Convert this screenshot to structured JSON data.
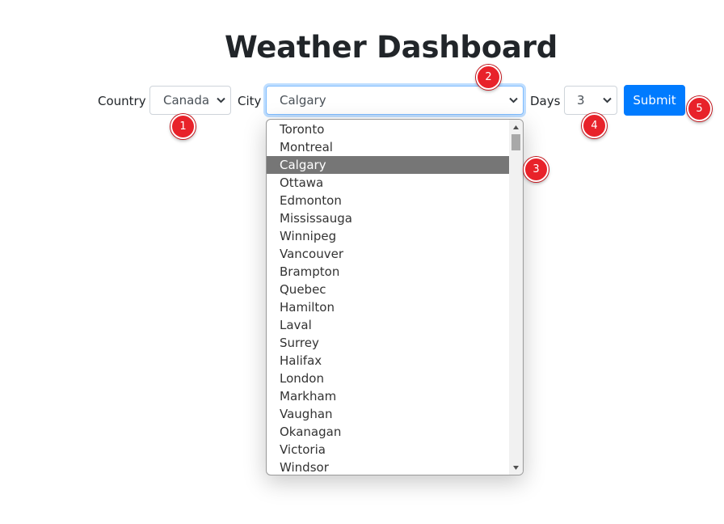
{
  "page_title": "Weather Dashboard",
  "form": {
    "country_label": "Country",
    "country_value": "Canada",
    "city_label": "City",
    "city_value": "Calgary",
    "days_label": "Days",
    "days_value": "3",
    "submit_label": "Submit"
  },
  "city_dropdown": {
    "options": [
      "Toronto",
      "Montreal",
      "Calgary",
      "Ottawa",
      "Edmonton",
      "Mississauga",
      "Winnipeg",
      "Vancouver",
      "Brampton",
      "Quebec",
      "Hamilton",
      "Laval",
      "Surrey",
      "Halifax",
      "London",
      "Markham",
      "Vaughan",
      "Okanagan",
      "Victoria",
      "Windsor"
    ],
    "selected": "Calgary"
  },
  "annotations": [
    "1",
    "2",
    "3",
    "4",
    "5"
  ],
  "colors": {
    "primary": "#007bff",
    "selected_option_bg": "#767676",
    "badge": "#e8222a",
    "focus_border": "#80bdff"
  },
  "icons": {
    "select_arrow": "chevron-down-icon",
    "scroll_up": "scroll-up-arrow-icon",
    "scroll_down": "scroll-down-arrow-icon"
  }
}
